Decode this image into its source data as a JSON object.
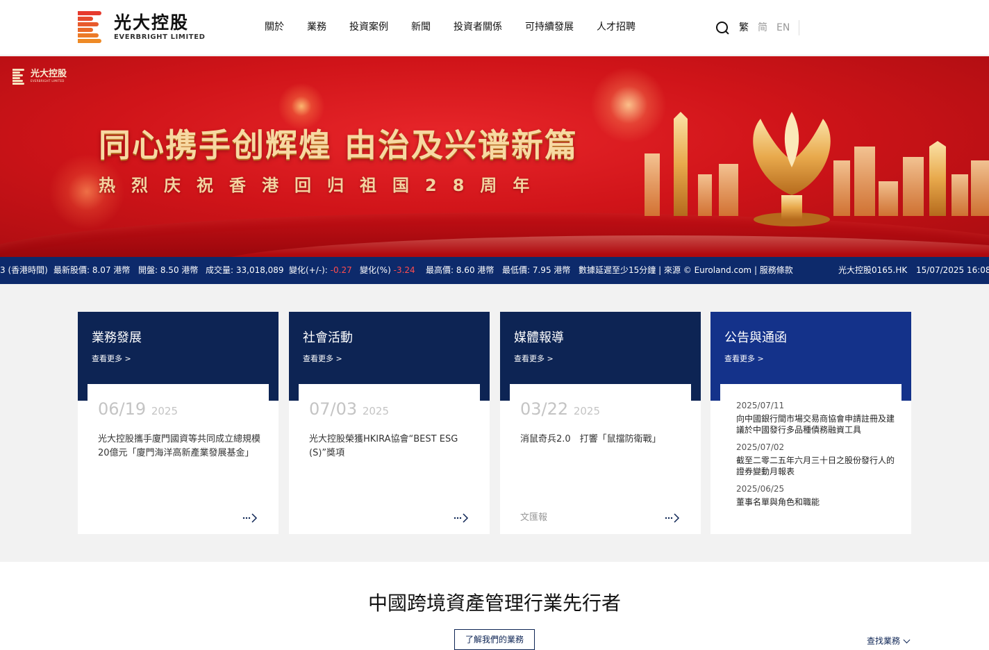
{
  "header": {
    "logo_cn": "光大控股",
    "logo_en": "EVERBRIGHT LIMITED",
    "nav": [
      "關於",
      "業務",
      "投資案例",
      "新聞",
      "投資者關係",
      "可持續發展",
      "人才招聘"
    ],
    "languages": [
      "繁",
      "简",
      "EN"
    ]
  },
  "banner": {
    "logo_cn": "光大控股",
    "logo_en": "EVERBRIGHT LIMITED",
    "title": "同心携手创辉煌  由治及兴谱新篇",
    "subtitle": "热烈庆祝香港回归祖国28周年"
  },
  "ticker": {
    "timezone": "3 (香港時間)",
    "last_price": "最新股價: 8.07 港幣",
    "open": "開盤: 8.50 港幣",
    "volume": "成交量: 33,018,089",
    "change_label": "變化(+/-):",
    "change_value": "-0.27",
    "change_pct_label": "變化(%)",
    "change_pct_value": "-3.24",
    "high": "最高價: 8.60 港幣",
    "low": "最低價: 7.95 港幣",
    "disclaimer": "數據延遲至少15分鐘 | 來源 © Euroland.com | 服務條款",
    "symbol": "光大控股0165.HK",
    "datetime": "15/07/2025 16:08"
  },
  "cards": [
    {
      "title": "業務發展",
      "more": "查看更多 >",
      "date_md": "06/19",
      "date_y": "2025",
      "text": "光大控股攜手廈門國資等共同成立總規模20億元「廈門海洋高新產業發展基金」"
    },
    {
      "title": "社會活動",
      "more": "查看更多 >",
      "date_md": "07/03",
      "date_y": "2025",
      "text": "光大控股榮獲HKIRA協會“BEST ESG (S)”獎項"
    },
    {
      "title": "媒體報導",
      "more": "查看更多 >",
      "date_md": "03/22",
      "date_y": "2025",
      "text": "消鼠奇兵2.0　打響「鼠擋防衛戰」",
      "source": "文匯報"
    },
    {
      "title": "公告與通函",
      "more": "查看更多 >",
      "items": [
        {
          "date": "2025/07/11",
          "text": "向中國銀行間市場交易商協會申請註冊及建議於中國發行多品種債務融資工具"
        },
        {
          "date": "2025/07/02",
          "text": "截至二零二五年六月三十日之股份發行人的證券變動月報表"
        },
        {
          "date": "2025/06/25",
          "text": "董事名單與角色和職能"
        }
      ]
    }
  ],
  "bottom": {
    "slogan": "中國跨境資產管理行業先行者",
    "learn_button": "了解我們的業務",
    "find_business": "查找業務"
  },
  "colors": {
    "navy": "#0d2454",
    "ticker_bg": "#0d2a6b",
    "banner_red": "#d01419",
    "negative": "#ff4d4f"
  }
}
